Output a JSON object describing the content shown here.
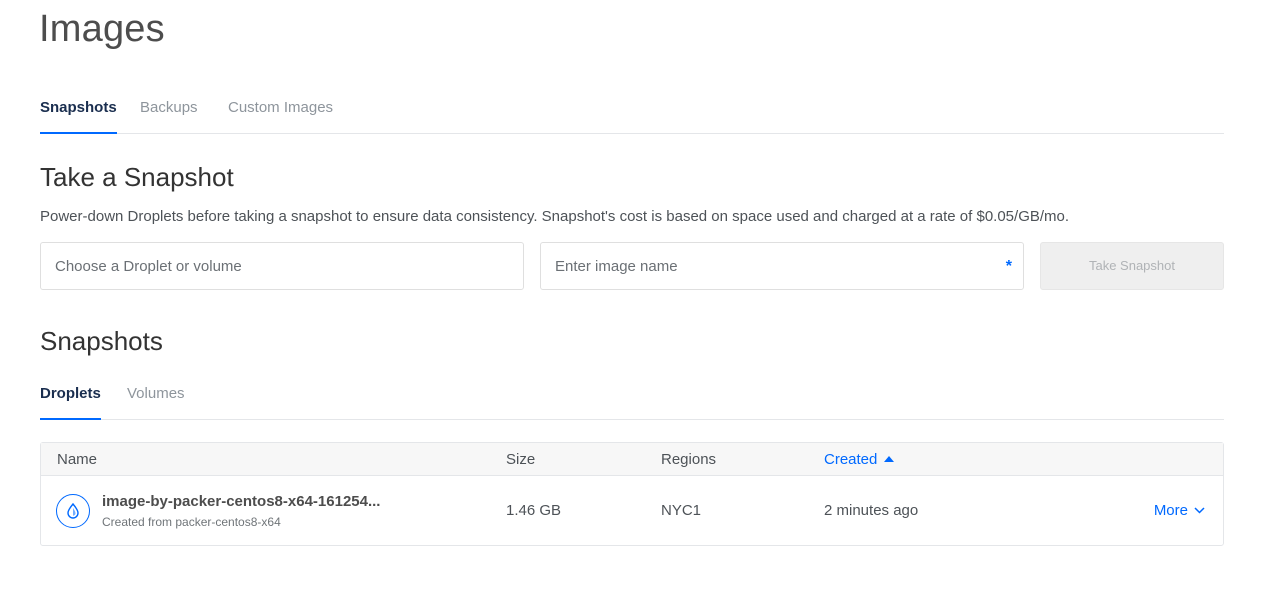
{
  "page": {
    "title": "Images"
  },
  "main_tabs": [
    "Snapshots",
    "Backups",
    "Custom Images"
  ],
  "take_snapshot": {
    "title": "Take a Snapshot",
    "description": "Power-down Droplets before taking a snapshot to ensure data consistency. Snapshot's cost is based on space used and charged at a rate of $0.05/GB/mo.",
    "droplet_placeholder": "Choose a Droplet or volume",
    "name_placeholder": "Enter image name",
    "required_marker": "*",
    "button_label": "Take Snapshot"
  },
  "snapshots": {
    "title": "Snapshots",
    "sub_tabs": [
      "Droplets",
      "Volumes"
    ],
    "columns": {
      "name": "Name",
      "size": "Size",
      "regions": "Regions",
      "created": "Created"
    },
    "rows": [
      {
        "name": "image-by-packer-centos8-x64-161254...",
        "sub": "Created from packer-centos8-x64",
        "size": "1.46 GB",
        "regions": "NYC1",
        "created": "2 minutes ago",
        "more": "More"
      }
    ]
  },
  "colors": {
    "accent": "#0069ff",
    "nav_active": "#1a2e4f"
  },
  "icons": {
    "row_icon": "droplet-icon",
    "sort": "sort-up-icon",
    "more": "chevron-down-icon"
  }
}
